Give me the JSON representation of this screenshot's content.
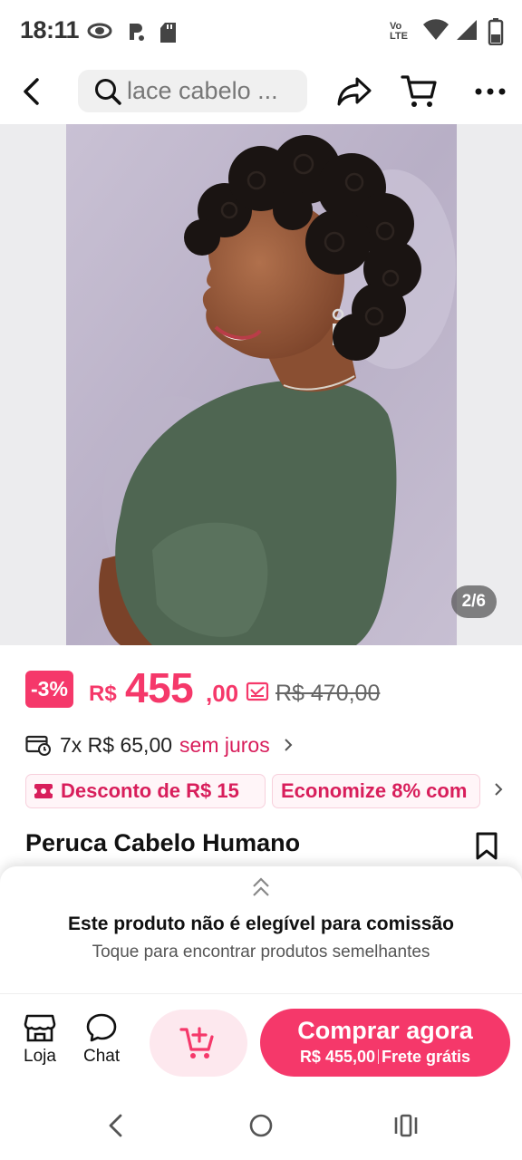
{
  "status_bar": {
    "time": "18:11",
    "icons_left": [
      "eye-icon",
      "notification-icon",
      "sd-card-icon"
    ],
    "icons_right": [
      "volte-icon",
      "wifi-icon",
      "signal-icon",
      "battery-icon"
    ],
    "network_label_top": "Vo",
    "network_label_bottom": "LTE"
  },
  "top_nav": {
    "search_text": "lace cabelo ...",
    "icons": [
      "back-icon",
      "search-icon",
      "share-icon",
      "cart-icon",
      "more-icon"
    ]
  },
  "product": {
    "image_counter": "2/6",
    "discount": "-3%",
    "currency": "R$",
    "price_main": "455",
    "price_cents": ",00",
    "price_old": "R$ 470,00",
    "installments": "7x R$ 65,00",
    "installments_accent": "sem juros",
    "coupons": [
      "Desconto de R$ 15",
      "Economize 8% com"
    ],
    "title": "Peruca Cabelo Humano"
  },
  "commission": {
    "title": "Este produto não é elegível para comissão",
    "subtitle": "Toque para encontrar produtos semelhantes"
  },
  "action_bar": {
    "store_label": "Loja",
    "chat_label": "Chat",
    "buy_title": "Comprar agora",
    "buy_price": "R$ 455,00",
    "buy_shipping": "Frete grátis"
  },
  "colors": {
    "accent": "#f5386a",
    "accent_dark": "#d81e5b",
    "accent_light": "#fde8ee"
  }
}
